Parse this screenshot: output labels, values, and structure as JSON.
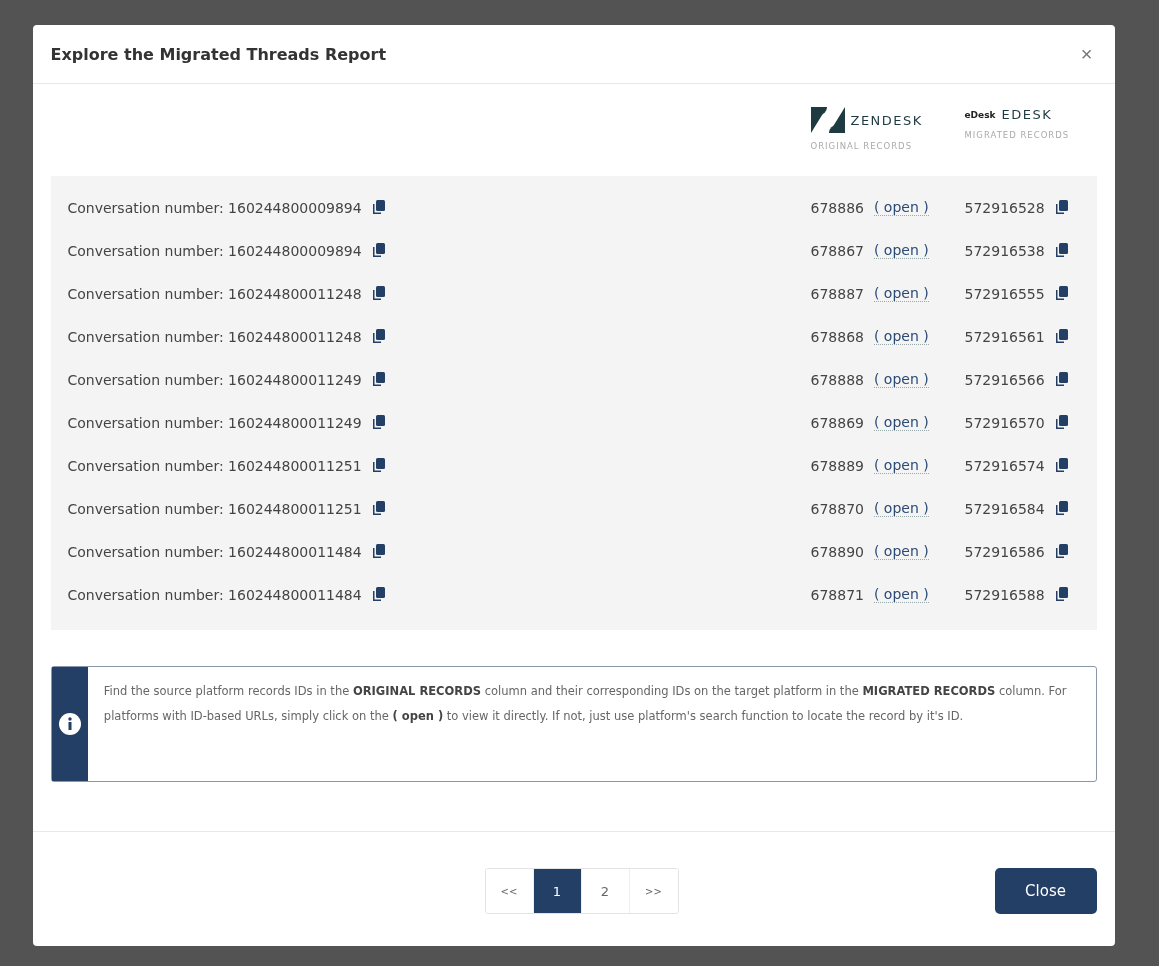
{
  "dialog": {
    "title": "Explore the Migrated Threads Report",
    "close_symbol": "×"
  },
  "platforms": [
    {
      "kind": "zendesk",
      "name": "ZENDESK",
      "caption": "ORIGINAL RECORDS"
    },
    {
      "kind": "edesk",
      "logo_text": "eDesk",
      "name": "EDESK",
      "caption": "MIGRATED RECORDS"
    }
  ],
  "rows": [
    {
      "label": "Conversation number: 160244800009894",
      "original_id": "678886",
      "open_label": "( open )",
      "migrated_id": "572916528"
    },
    {
      "label": "Conversation number: 160244800009894",
      "original_id": "678867",
      "open_label": "( open )",
      "migrated_id": "572916538"
    },
    {
      "label": "Conversation number: 160244800011248",
      "original_id": "678887",
      "open_label": "( open )",
      "migrated_id": "572916555"
    },
    {
      "label": "Conversation number: 160244800011248",
      "original_id": "678868",
      "open_label": "( open )",
      "migrated_id": "572916561"
    },
    {
      "label": "Conversation number: 160244800011249",
      "original_id": "678888",
      "open_label": "( open )",
      "migrated_id": "572916566"
    },
    {
      "label": "Conversation number: 160244800011249",
      "original_id": "678869",
      "open_label": "( open )",
      "migrated_id": "572916570"
    },
    {
      "label": "Conversation number: 160244800011251",
      "original_id": "678889",
      "open_label": "( open )",
      "migrated_id": "572916574"
    },
    {
      "label": "Conversation number: 160244800011251",
      "original_id": "678870",
      "open_label": "( open )",
      "migrated_id": "572916584"
    },
    {
      "label": "Conversation number: 160244800011484",
      "original_id": "678890",
      "open_label": "( open )",
      "migrated_id": "572916586"
    },
    {
      "label": "Conversation number: 160244800011484",
      "original_id": "678871",
      "open_label": "( open )",
      "migrated_id": "572916588"
    }
  ],
  "info": {
    "text": "Find the source platform records IDs in the **ORIGINAL RECORDS** column and their corresponding IDs on the target platform in the **MIGRATED RECORDS** column. For platforms with ID-based URLs, simply click on the **( open )** to view it directly. If not, just use platform's search function to locate the record by it's ID."
  },
  "pagination": [
    {
      "label": "<<",
      "selected": false
    },
    {
      "label": "1",
      "selected": true
    },
    {
      "label": "2",
      "selected": false
    },
    {
      "label": ">>",
      "selected": false
    }
  ],
  "footer": {
    "close_button": "Close"
  }
}
